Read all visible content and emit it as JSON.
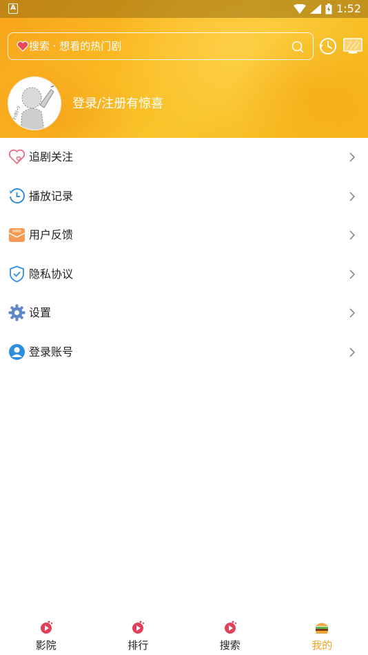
{
  "statusbar": {
    "notification_letter": "A",
    "time": "1:52"
  },
  "search": {
    "placeholder": "搜索 · 想看的热门剧"
  },
  "profile": {
    "login_prompt": "登录/注册有惊喜"
  },
  "menu": {
    "items": [
      {
        "label": "追剧关注",
        "icon": "heart-icon"
      },
      {
        "label": "播放记录",
        "icon": "history-icon"
      },
      {
        "label": "用户反馈",
        "icon": "feedback-icon"
      },
      {
        "label": "隐私协议",
        "icon": "shield-icon"
      },
      {
        "label": "设置",
        "icon": "gear-icon"
      },
      {
        "label": "登录账号",
        "icon": "user-icon"
      }
    ]
  },
  "bottom_nav": {
    "items": [
      {
        "label": "影院",
        "active": false
      },
      {
        "label": "排行",
        "active": false
      },
      {
        "label": "搜索",
        "active": false
      },
      {
        "label": "我的",
        "active": true
      }
    ]
  },
  "colors": {
    "accent": "#f3a320",
    "header": "#fbb923",
    "nav_icon": "#e0405a"
  }
}
